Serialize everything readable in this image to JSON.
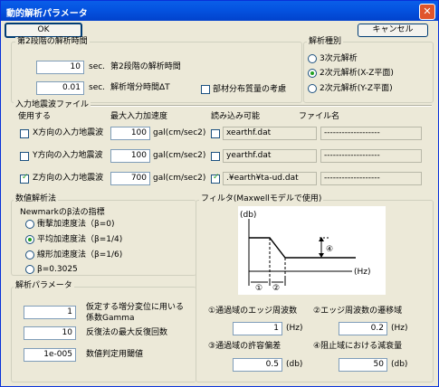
{
  "window": {
    "title": "動的解析パラメータ",
    "close_glyph": "✕"
  },
  "toolbar": {
    "ok_label": "OK",
    "cancel_label": "キャンセル"
  },
  "stage2": {
    "group_title": "第2段階の解析時間",
    "duration_value": "10",
    "duration_unit": "sec.",
    "duration_label": "第2段階の解析時間",
    "timestep_value": "0.01",
    "timestep_unit": "sec.",
    "timestep_label": "解析増分時間ΔT",
    "distributed_mass_label": "部材分布質量の考慮",
    "distributed_mass_checked": false
  },
  "analysis_type": {
    "group_title": "解析種別",
    "options": [
      "3次元解析",
      "2次元解析(X-Z平面)",
      "2次元解析(Y-Z平面)"
    ],
    "selected_index": 1
  },
  "input_wave": {
    "group_title": "入力地震波ファイル",
    "col_use": "使用する",
    "col_max_accel": "最大入力加速度",
    "col_readable": "読み込み可能",
    "col_filename": "ファイル名",
    "unit": "gal(cm/sec2)",
    "rows": [
      {
        "label": "X方向の入力地震波",
        "checked": false,
        "accel": "100",
        "readable": false,
        "file": "xearthf.dat",
        "name": "-------------------"
      },
      {
        "label": "Y方向の入力地震波",
        "checked": false,
        "accel": "100",
        "readable": false,
        "file": "yearthf.dat",
        "name": "-------------------"
      },
      {
        "label": "Z方向の入力地震波",
        "checked": true,
        "accel": "700",
        "readable": true,
        "file": ".¥earth¥ta-ud.dat",
        "name": "-------------------"
      }
    ]
  },
  "numerical": {
    "group_title": "数値解析法",
    "newmark_title": "Newmarkのβ法の指標",
    "options": [
      "衝撃加速度法（β=0)",
      "平均加速度法（β=1/4)",
      "線形加速度法（β=1/6)",
      "β=0.3025"
    ],
    "selected_index": 1
  },
  "params": {
    "group_title": "解析パラメータ",
    "gamma_value": "1",
    "gamma_label_1": "仮定する増分変位に用いる",
    "gamma_label_2": "係数Gamma",
    "iter_value": "10",
    "iter_label": "反復法の最大反復回数",
    "conv_value": "1e-005",
    "conv_label": "数値判定用閾値"
  },
  "filter": {
    "group_title": "フィルタ(Maxwellモデルで使用)",
    "diagram": {
      "y_label": "(db)",
      "x_label": "(Hz)",
      "mark_1": "①",
      "mark_2": "②",
      "mark_4": "④"
    },
    "passband_freq_label": "①通過域のエッジ周波数",
    "passband_freq_value": "1",
    "passband_freq_unit": "(Hz)",
    "transition_label": "②エッジ周波数の遷移域",
    "transition_value": "0.2",
    "transition_unit": "(Hz)",
    "ripple_label": "③通過域の許容偏差",
    "ripple_value": "0.5",
    "ripple_unit": "(db)",
    "attenuation_label": "④阻止域における減衰量",
    "attenuation_value": "50",
    "attenuation_unit": "(db)"
  }
}
